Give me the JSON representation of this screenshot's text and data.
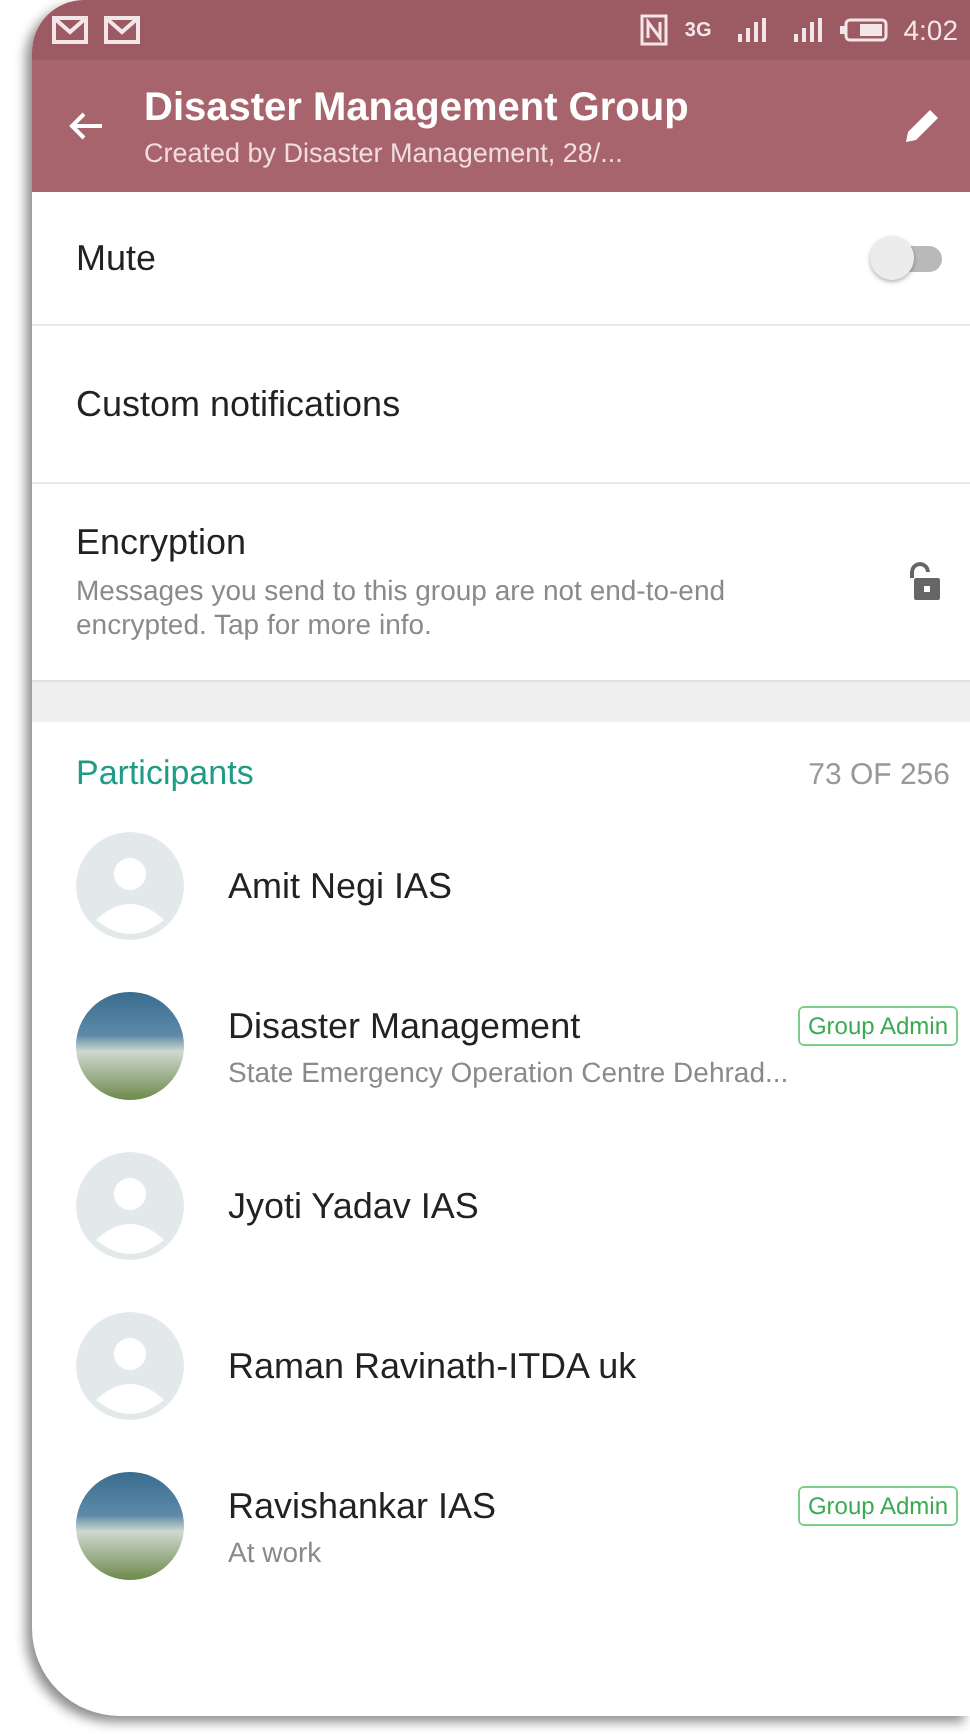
{
  "status_bar": {
    "network": "3G",
    "time": "4:02"
  },
  "header": {
    "title": "Disaster Management Group",
    "subtitle": "Created by Disaster Management, 28/..."
  },
  "settings": [
    {
      "kind": "toggle",
      "label": "Mute",
      "on": false
    },
    {
      "kind": "plain",
      "label": "Custom notifications"
    },
    {
      "kind": "lock",
      "label": "Encryption",
      "description": "Messages you send to this group are not end-to-end encrypted. Tap for more info."
    }
  ],
  "participants": {
    "title": "Participants",
    "count": "73 OF 256",
    "items": [
      {
        "kind": "default",
        "name": "Amit Negi IAS"
      },
      {
        "kind": "photo",
        "name": "Disaster Management",
        "badge": "Group Admin",
        "status": "State Emergency Operation Centre Dehrad..."
      },
      {
        "kind": "default",
        "name": "Jyoti Yadav IAS"
      },
      {
        "kind": "default",
        "name": "Raman Ravinath-ITDA uk"
      },
      {
        "kind": "photo",
        "name": "Ravishankar IAS",
        "badge": "Group Admin",
        "status": "At work"
      }
    ]
  }
}
